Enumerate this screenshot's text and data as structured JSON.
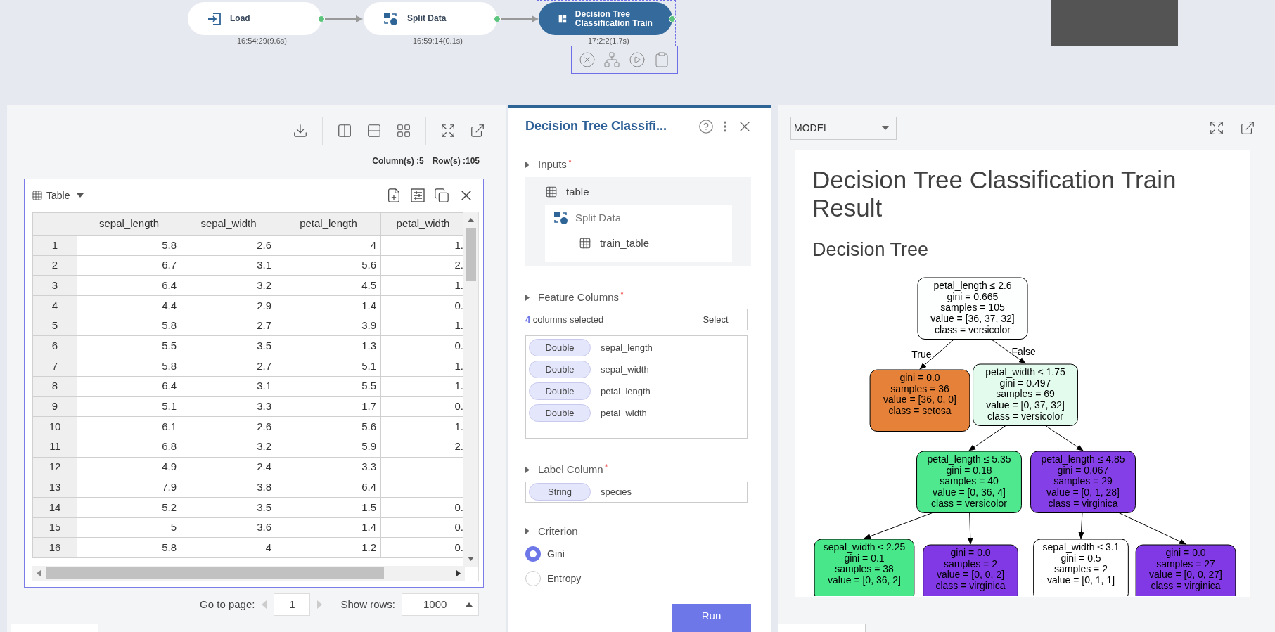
{
  "pipeline": {
    "nodes": [
      {
        "label": "Load",
        "time": "16:54:29(9.6s)",
        "kind": "load",
        "selected": false
      },
      {
        "label": "Split Data",
        "time": "16:59:14(0.1s)",
        "kind": "split",
        "selected": false
      },
      {
        "label": "Decision Tree Classification Train",
        "time": "17:2:2(1.7s)",
        "kind": "tree",
        "selected": true
      }
    ]
  },
  "data_panel": {
    "summary": [
      "Column(s) :5",
      "Row(s) :105"
    ],
    "table": {
      "view_label": "Table",
      "columns": [
        "sepal_length",
        "sepal_width",
        "petal_length",
        "petal_width"
      ],
      "rows": [
        {
          "index": "1",
          "cells": [
            "5.8",
            "2.6",
            "4",
            "1."
          ]
        },
        {
          "index": "2",
          "cells": [
            "6.7",
            "3.1",
            "5.6",
            "2."
          ]
        },
        {
          "index": "3",
          "cells": [
            "6.4",
            "3.2",
            "4.5",
            "1."
          ]
        },
        {
          "index": "4",
          "cells": [
            "4.4",
            "2.9",
            "1.4",
            "0."
          ]
        },
        {
          "index": "5",
          "cells": [
            "5.8",
            "2.7",
            "3.9",
            "1."
          ]
        },
        {
          "index": "6",
          "cells": [
            "5.5",
            "3.5",
            "1.3",
            "0."
          ]
        },
        {
          "index": "7",
          "cells": [
            "5.8",
            "2.7",
            "5.1",
            "1."
          ]
        },
        {
          "index": "8",
          "cells": [
            "6.4",
            "3.1",
            "5.5",
            "1."
          ]
        },
        {
          "index": "9",
          "cells": [
            "5.1",
            "3.3",
            "1.7",
            "0."
          ]
        },
        {
          "index": "10",
          "cells": [
            "6.1",
            "2.6",
            "5.6",
            "1."
          ]
        },
        {
          "index": "11",
          "cells": [
            "6.8",
            "3.2",
            "5.9",
            "2."
          ]
        },
        {
          "index": "12",
          "cells": [
            "4.9",
            "2.4",
            "3.3"
          ]
        },
        {
          "index": "13",
          "cells": [
            "7.9",
            "3.8",
            "6.4"
          ]
        },
        {
          "index": "14",
          "cells": [
            "5.2",
            "3.5",
            "1.5",
            "0."
          ]
        },
        {
          "index": "15",
          "cells": [
            "5",
            "3.6",
            "1.4",
            "0."
          ]
        },
        {
          "index": "16",
          "cells": [
            "5.8",
            "4",
            "1.2",
            "0."
          ]
        }
      ]
    },
    "pagination": {
      "go_to_label": "Go to page:",
      "page": "1",
      "show_rows_label": "Show rows:",
      "rows_value": "1000"
    }
  },
  "settings_panel": {
    "title": "Decision Tree Classifi...",
    "inputs": {
      "label": "Inputs",
      "required_mark": "*",
      "port": "table",
      "source": "Split Data",
      "output": "train_table"
    },
    "feature_columns": {
      "label": "Feature Columns",
      "required_mark": "*",
      "count": "4",
      "count_text": "columns selected",
      "button": "Select",
      "columns": [
        {
          "type": "Double",
          "name": "sepal_length"
        },
        {
          "type": "Double",
          "name": "sepal_width"
        },
        {
          "type": "Double",
          "name": "petal_length"
        },
        {
          "type": "Double",
          "name": "petal_width"
        }
      ]
    },
    "label_column": {
      "label": "Label Column",
      "required_mark": "*",
      "type": "String",
      "name": "species"
    },
    "criterion": {
      "label": "Criterion",
      "options": [
        {
          "label": "Gini",
          "selected": true
        },
        {
          "label": "Entropy",
          "selected": false
        }
      ]
    },
    "run_button": "Run"
  },
  "result_panel": {
    "view_select": "MODEL",
    "title": "Decision Tree Classification Train Result",
    "subtitle": "Decision Tree",
    "tree": {
      "lines": [
        "petal_length ≤ 2.6",
        "gini = 0.665",
        "samples = 105",
        "value = [36, 37, 32]",
        "class = versicolor"
      ],
      "color": "#fdfffe",
      "children": [
        {
          "edge_label": "True",
          "lines": [
            "gini = 0.0",
            "samples = 36",
            "value = [36, 0, 0]",
            "class = setosa"
          ],
          "color": "#e58139"
        },
        {
          "edge_label": "False",
          "lines": [
            "petal_width ≤ 1.75",
            "gini = 0.497",
            "samples = 69",
            "value = [0, 37, 32]",
            "class = versicolor"
          ],
          "color": "#e3fbed",
          "children": [
            {
              "lines": [
                "petal_length ≤ 5.35",
                "gini = 0.18",
                "samples = 40",
                "value = [0, 36, 4]",
                "class = versicolor"
              ],
              "color": "#4fe88f",
              "children": [
                {
                  "lines": [
                    "sepal_width ≤ 2.25",
                    "gini = 0.1",
                    "samples = 38",
                    "value = [0, 36, 2]"
                  ],
                  "color": "#48e78a"
                },
                {
                  "lines": [
                    "gini = 0.0",
                    "samples = 2",
                    "value = [0, 0, 2]",
                    "class = virginica"
                  ],
                  "color": "#8139e5"
                }
              ]
            },
            {
              "lines": [
                "petal_length ≤ 4.85",
                "gini = 0.067",
                "samples = 29",
                "value = [0, 1, 28]",
                "class = virginica"
              ],
              "color": "#853fe6",
              "children": [
                {
                  "lines": [
                    "sepal_width ≤ 3.1",
                    "gini = 0.5",
                    "samples = 2",
                    "value = [0, 1, 1]"
                  ],
                  "color": "#ffffff"
                },
                {
                  "lines": [
                    "gini = 0.0",
                    "samples = 27",
                    "value = [0, 0, 27]",
                    "class = virginica"
                  ],
                  "color": "#8139e5"
                }
              ]
            }
          ]
        }
      ]
    }
  }
}
